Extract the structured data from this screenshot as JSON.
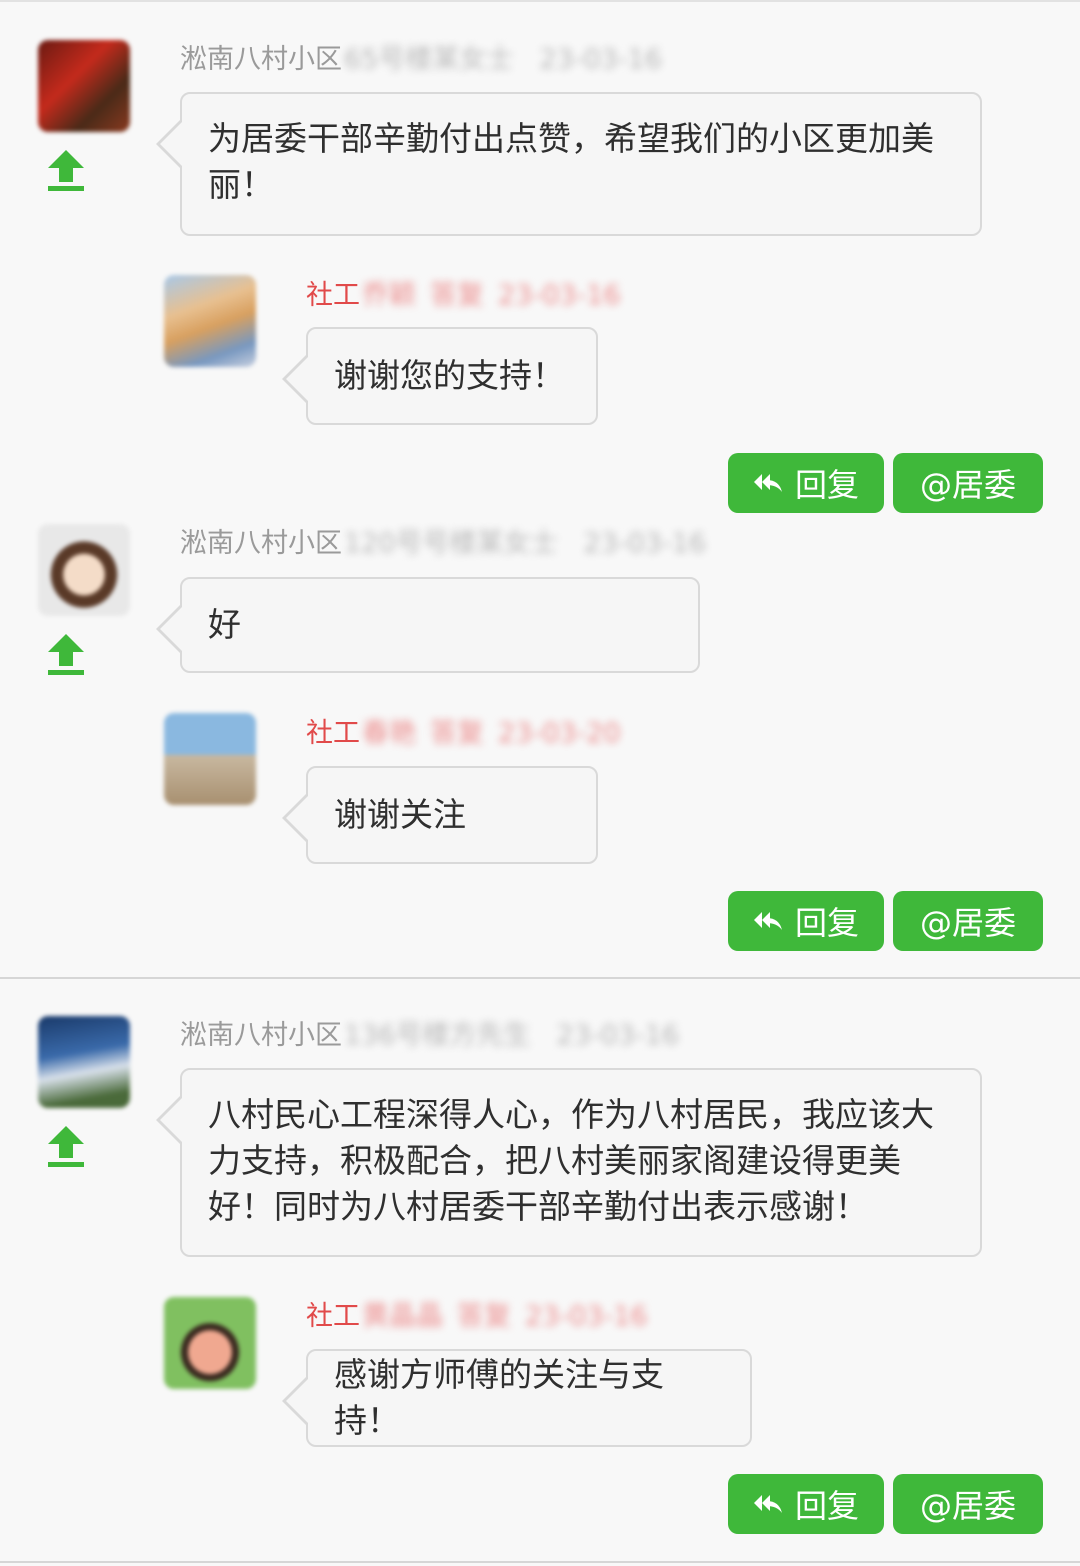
{
  "colors": {
    "accent_green": "#3fb83a",
    "reply_red": "#e14a4a",
    "text_gray": "#9a9a9a"
  },
  "icons": {
    "upvote": "up-arrow-icon",
    "reply": "reply-arrow-icon"
  },
  "buttons": {
    "reply_label": "回复",
    "at_label": "@居委"
  },
  "threads": [
    {
      "comment": {
        "community": "淞南八村小区",
        "user_blurred": "65号楼某女士",
        "date": "23-03-16",
        "text": "为居委干部辛勤付出点赞，希望我们的小区更加美丽！"
      },
      "replies": [
        {
          "role": "社工",
          "name_blurred": "乔颖",
          "tag_blurred": "答复",
          "date": "23-03-16",
          "text": "谢谢您的支持！"
        }
      ]
    },
    {
      "comment": {
        "community": "淞南八村小区",
        "user_blurred": "120号号楼某女士",
        "date": "23-03-16",
        "text": "好"
      },
      "replies": [
        {
          "role": "社工",
          "name_blurred": "春艳",
          "tag_blurred": "答复",
          "date": "23-03-20",
          "text": "谢谢关注"
        }
      ]
    },
    {
      "comment": {
        "community": "淞南八村小区",
        "user_blurred": "136号楼方先生",
        "date": "23-03-16",
        "text": "八村民心工程深得人心，作为八村居民，我应该大力支持，积极配合，把八村美丽家阁建设得更美好！同时为八村居委干部辛勤付出表示感谢！"
      },
      "replies": [
        {
          "role": "社工",
          "name_blurred": "黄晶晶",
          "tag_blurred": "答复",
          "date": "23-03-16",
          "text": "感谢方师傅的关注与支持！"
        }
      ]
    }
  ]
}
